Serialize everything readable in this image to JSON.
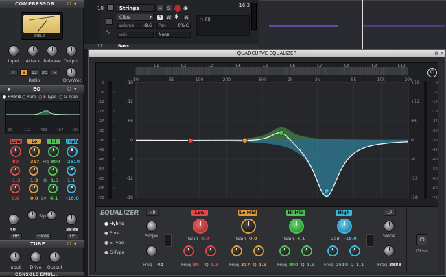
{
  "strip": {
    "compressor": {
      "title": "COMPRESSOR",
      "meter_brand": "EXELIS",
      "knobs": [
        "Input",
        "Attack",
        "Release",
        "Output"
      ],
      "ratio_buttons": [
        "4",
        "8",
        "12",
        "20",
        "∞"
      ],
      "ratio_label": "Ratio",
      "drywet_label": "Dry/Wet"
    },
    "eq": {
      "title": "EQ",
      "modes": [
        "Hybrid",
        "Pure",
        "E-Type",
        "G-Type"
      ],
      "freq_ticks": [
        "20",
        "112",
        "462",
        "1k7",
        "10k"
      ],
      "bands": [
        "Low",
        "Lo Mid",
        "Hi Mid",
        "High"
      ],
      "gain": [
        "80",
        "317",
        "Frq",
        "800",
        "2510"
      ],
      "row_q": [
        "1.3",
        "1.3",
        "Q",
        "1.3",
        "1.1"
      ],
      "row_lvl": [
        "0.0",
        "0.0",
        "Lvl",
        "4.1",
        "-18.0"
      ],
      "slp_label": "Slp",
      "freq_lo": "40",
      "freq_hi": "3888",
      "hp": "HP",
      "gloss": "Gloss",
      "lp": "LP"
    },
    "tube": {
      "title": "TUBE",
      "knobs": [
        "Input",
        "Drive",
        "Output"
      ]
    },
    "console": {
      "title": "CONSOLE EMUL..."
    }
  },
  "tracks": {
    "track10": {
      "number": "10",
      "name": "Strings",
      "clips": "Clips",
      "volume_label": "Volume",
      "volume_value": "-9.6",
      "pan_label": "Pan",
      "pan_value": "0% C",
      "vals_label": "Vals",
      "value_db": "-16.3",
      "fx_label": "FX",
      "none_label": "None",
      "buttons": [
        "M",
        "S",
        "R",
        "W",
        "A"
      ]
    },
    "track11": {
      "number": "11",
      "name": "Bass"
    }
  },
  "eq_window": {
    "title": "QUADCURVE EQUALIZER",
    "notes": [
      "C1",
      "C2",
      "C3",
      "C4",
      "C5",
      "C6",
      "C7",
      "C8",
      "C9",
      "C10"
    ],
    "freq_labels": [
      "20",
      "50",
      "100",
      "200",
      "500",
      "1k",
      "2k",
      "5k",
      "10k",
      "20k"
    ],
    "db_left_outer": [
      "0",
      "-6",
      "-12",
      "-18",
      "-24",
      "-30",
      "-36",
      "-42",
      "-48",
      "-54",
      "-60",
      "-66",
      "-72"
    ],
    "db_inner": [
      "+18",
      "+12",
      "+6",
      "0",
      "-6",
      "-12",
      "-18"
    ],
    "db_right": [
      "+18",
      "+12",
      "+6",
      "0",
      "-6",
      "-12",
      "-18"
    ],
    "db_right_outer": [
      "0",
      "-6",
      "-12",
      "-18",
      "-24",
      "-30",
      "-36",
      "-42",
      "-48",
      "-54",
      "-60",
      "-66",
      "-72"
    ],
    "controls": {
      "equalizer_label": "EQUALIZER",
      "modes": [
        "Hybrid",
        "Pure",
        "E-Type",
        "G-Type"
      ],
      "hp": {
        "label": "HP",
        "slope_label": "Slope",
        "freq_label": "Freq",
        "freq_value": "40"
      },
      "low": {
        "label": "Low",
        "gain_label": "Gain",
        "gain_value": "0.0",
        "freq_label": "Freq",
        "freq_value": "80",
        "q_label": "Q",
        "q_value": "1.3",
        "color": "#e04848"
      },
      "lomid": {
        "label": "Lo Mid",
        "gain_label": "Gain",
        "gain_value": "0.0",
        "freq_label": "Freq",
        "freq_value": "317",
        "q_label": "Q",
        "q_value": "1.3",
        "color": "#e09a38"
      },
      "himid": {
        "label": "Hi Mid",
        "gain_label": "Gain",
        "gain_value": "4.1",
        "freq_label": "Freq",
        "freq_value": "800",
        "q_label": "Q",
        "q_value": "1.3",
        "color": "#4fc254"
      },
      "high": {
        "label": "High",
        "gain_label": "Gain",
        "gain_value": "-18.0",
        "freq_label": "Freq",
        "freq_value": "2510",
        "q_label": "Q",
        "q_value": "1.1",
        "color": "#38b6e0"
      },
      "lp": {
        "label": "LP",
        "slope_label": "Slope",
        "freq_label": "Freq",
        "freq_value": "3888"
      },
      "gloss_label": "Gloss"
    }
  }
}
